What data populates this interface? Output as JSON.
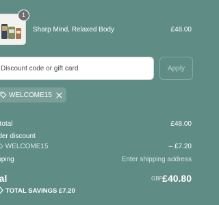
{
  "cart_item": {
    "name": "Sharp Mind, Relaxed Body",
    "price": "£48.00",
    "quantity": "1"
  },
  "discount": {
    "placeholder": "Discount code or gift card",
    "apply_label": "Apply",
    "applied_code": "WELCOME15"
  },
  "summary": {
    "subtotal_label": "btotal",
    "subtotal_value": "£48.00",
    "order_discount_label": "rder discount",
    "discount_code_line": "WELCOME15",
    "discount_value": "– £7.20",
    "shipping_label": "ipping",
    "shipping_value": "Enter shipping address",
    "total_label": "tal",
    "currency": "GBP",
    "total_value": "£40.80",
    "savings_label": "TOTAL SAVINGS",
    "savings_value": "£7.20"
  },
  "colors": {
    "background": "#5f8d86",
    "text": "#ffffff"
  },
  "icons": {
    "chip_tag": "tag-icon",
    "chip_remove": "close-icon",
    "savings": "tag-icon"
  }
}
